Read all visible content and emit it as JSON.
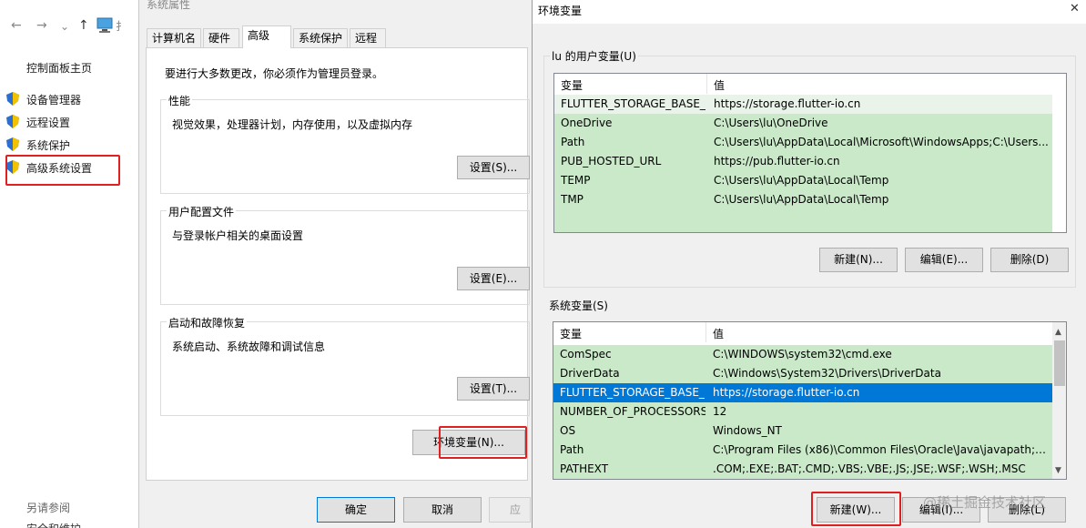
{
  "control_panel": {
    "nav": {
      "back": "←",
      "forward": "→",
      "up": "↑"
    },
    "address_fragment": "扌",
    "home_link": "控制面板主页",
    "links": [
      "设备管理器",
      "远程设置",
      "系统保护",
      "高级系统设置"
    ],
    "see_also": "另请参阅",
    "bottom_cut": "安全和维护"
  },
  "sysprops": {
    "title": "系统属性",
    "tabs": [
      "计算机名",
      "硬件",
      "高级",
      "系统保护",
      "远程"
    ],
    "admin_note": "要进行大多数更改，你必须作为管理员登录。",
    "groups": [
      {
        "label": "性能",
        "desc": "视觉效果，处理器计划，内存使用，以及虚拟内存",
        "button": "设置(S)..."
      },
      {
        "label": "用户配置文件",
        "desc": "与登录帐户相关的桌面设置",
        "button": "设置(E)..."
      },
      {
        "label": "启动和故障恢复",
        "desc": "系统启动、系统故障和调试信息",
        "button": "设置(T)..."
      }
    ],
    "env_button": "环境变量(N)...",
    "ok": "确定",
    "cancel": "取消",
    "apply": "应用"
  },
  "envdlg": {
    "title": "环境变量",
    "close": "✕",
    "user_group_label": "lu 的用户变量(U)",
    "col_var": "变量",
    "col_val": "值",
    "user_vars": [
      [
        "FLUTTER_STORAGE_BASE_...",
        "https://storage.flutter-io.cn"
      ],
      [
        "OneDrive",
        "C:\\Users\\lu\\OneDrive"
      ],
      [
        "Path",
        "C:\\Users\\lu\\AppData\\Local\\Microsoft\\WindowsApps;C:\\Users..."
      ],
      [
        "PUB_HOSTED_URL",
        "https://pub.flutter-io.cn"
      ],
      [
        "TEMP",
        "C:\\Users\\lu\\AppData\\Local\\Temp"
      ],
      [
        "TMP",
        "C:\\Users\\lu\\AppData\\Local\\Temp"
      ]
    ],
    "user_buttons": [
      "新建(N)...",
      "编辑(E)...",
      "删除(D)"
    ],
    "sys_group_label": "系统变量(S)",
    "sys_vars": [
      [
        "ComSpec",
        "C:\\WINDOWS\\system32\\cmd.exe"
      ],
      [
        "DriverData",
        "C:\\Windows\\System32\\Drivers\\DriverData"
      ],
      [
        "FLUTTER_STORAGE_BASE_...",
        "https://storage.flutter-io.cn"
      ],
      [
        "NUMBER_OF_PROCESSORS",
        "12"
      ],
      [
        "OS",
        "Windows_NT"
      ],
      [
        "Path",
        "C:\\Program Files (x86)\\Common Files\\Oracle\\Java\\javapath;C:..."
      ],
      [
        "PATHEXT",
        ".COM;.EXE;.BAT;.CMD;.VBS;.VBE;.JS;.JSE;.WSF;.WSH;.MSC"
      ]
    ],
    "sys_buttons": [
      "新建(W)...",
      "编辑(I)...",
      "删除(L)"
    ]
  },
  "watermark": "@稀土掘金技术社区",
  "colors": {
    "highlight": "#e02020",
    "row_green": "#c9e9c9",
    "selection": "#0078d7"
  }
}
